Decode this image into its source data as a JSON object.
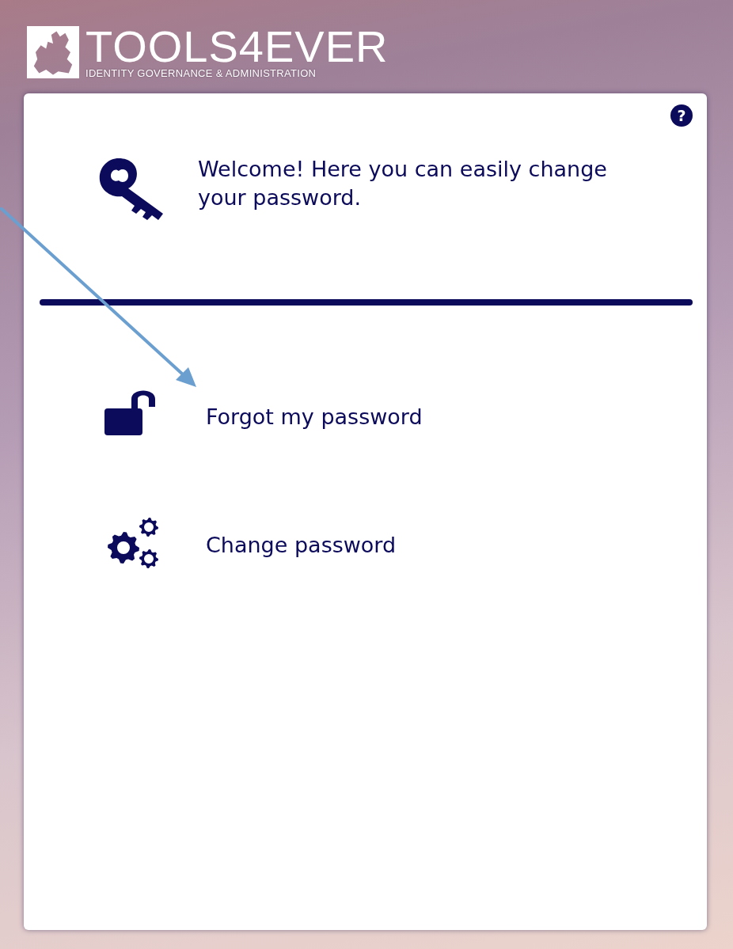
{
  "logo": {
    "name": "TOOLS4EVER",
    "tagline": "IDENTITY GOVERNANCE & ADMINISTRATION"
  },
  "help": "?",
  "welcome": {
    "text": "Welcome! Here you can easily change your password."
  },
  "menu": [
    {
      "kind": "unlock",
      "label": "Forgot my password"
    },
    {
      "kind": "gears",
      "label": "Change password"
    }
  ]
}
